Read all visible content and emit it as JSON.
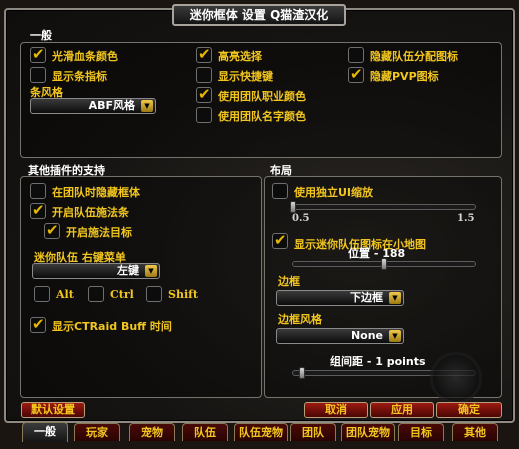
{
  "window": {
    "title": "迷你框体 设置 Q猫渣汉化"
  },
  "general": {
    "title": "一般",
    "checkboxes": [
      {
        "label": "光滑血条颜色",
        "checked": true
      },
      {
        "label": "显示条指标",
        "checked": false
      },
      {
        "label": "高亮选择",
        "checked": true
      },
      {
        "label": "显示快捷键",
        "checked": false
      },
      {
        "label": "使用团队职业颜色",
        "checked": true
      },
      {
        "label": "使用团队名字颜色",
        "checked": false
      },
      {
        "label": "隐藏队伍分配图标",
        "checked": false
      },
      {
        "label": "隐藏PVP图标",
        "checked": true
      }
    ],
    "bar_style_label": "条风格",
    "bar_style_value": "ABF风格"
  },
  "addons": {
    "title": "其他插件的支持",
    "hide_in_raid": {
      "label": "在团队时隐藏框体",
      "checked": false
    },
    "party_castbar": {
      "label": "开启队伍施法条",
      "checked": true
    },
    "cast_target": {
      "label": "开启施法目标",
      "checked": true
    },
    "mini_party_label": "迷你队伍 右键菜单",
    "mouse_button_value": "左键",
    "modifiers": [
      {
        "label": "Alt",
        "checked": false
      },
      {
        "label": "Ctrl",
        "checked": false
      },
      {
        "label": "Shift",
        "checked": false
      }
    ],
    "ctraid": {
      "label": "显示CTRaid Buff 时间",
      "checked": true
    }
  },
  "layout": {
    "title": "布局",
    "independent_scale": {
      "label": "使用独立UI缩放",
      "checked": false
    },
    "scale_min": "0.5",
    "scale_max": "1.5",
    "scale_value": 0.5,
    "show_minimap_icon": {
      "label": "显示迷你队伍图标在小地图",
      "checked": true
    },
    "position_label": "位置 - 188",
    "position_fraction": 0.5,
    "border_label": "边框",
    "border_value": "下边框",
    "border_style_label": "边框风格",
    "border_style_value": "None",
    "spacing_label": "组间距 - 1 points",
    "spacing_fraction": 0.05
  },
  "buttons": {
    "defaults": "默认设置",
    "cancel": "取消",
    "apply": "应用",
    "ok": "确定"
  },
  "tabs": [
    "一般",
    "玩家",
    "宠物",
    "队伍",
    "队伍宠物",
    "团队",
    "团队宠物",
    "目标",
    "其他"
  ],
  "active_tab": 0,
  "colors": {
    "accent": "#f2c61f",
    "button_red": "#9d1a12",
    "white_text": "#ffffff"
  }
}
